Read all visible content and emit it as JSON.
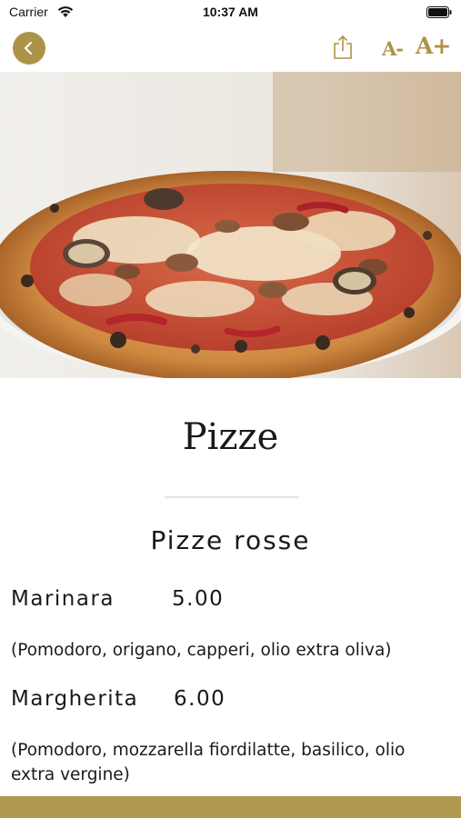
{
  "status_bar": {
    "carrier": "Carrier",
    "time": "10:37 AM",
    "wifi_icon": "wifi-icon",
    "battery_icon": "battery-icon"
  },
  "nav": {
    "back_icon": "chevron-left-icon",
    "share_icon": "share-icon",
    "font_decrease_label": "A-",
    "font_increase_label": "A+",
    "accent_color": "#ad9348"
  },
  "hero": {
    "image": "pizza-photo"
  },
  "menu": {
    "title": "Pizze",
    "section_title": "Pizze rosse",
    "items": [
      {
        "name": "Marinara",
        "price": "5.00",
        "description": "(Pomodoro, origano, capperi, olio extra oliva)"
      },
      {
        "name": "Margherita",
        "price": "6.00",
        "description": "(Pomodoro, mozzarella fiordilatte, basilico, olio extra vergine)"
      }
    ]
  },
  "colors": {
    "accent": "#ad9348",
    "bottom_bar": "#b09a52",
    "divider": "#e2e2e2",
    "text": "#1a1a1a"
  }
}
